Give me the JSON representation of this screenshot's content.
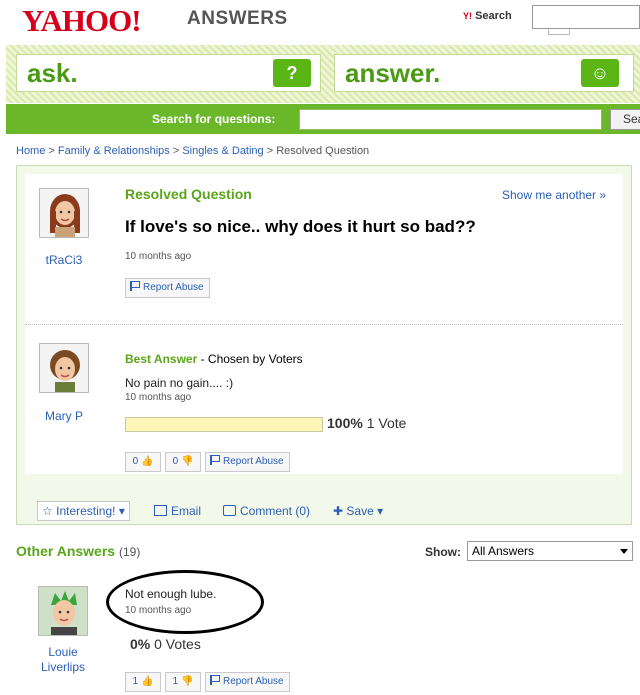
{
  "header": {
    "logo": "YAHOO!",
    "section": "ANSWERS",
    "search_label": "Search",
    "search_logo": "Y!"
  },
  "band": {
    "ask": "ask.",
    "answer": "answer.",
    "ask_icon": "?",
    "answer_icon": "☺"
  },
  "searchbar": {
    "label": "Search for questions:",
    "button": "Search"
  },
  "breadcrumb": {
    "items": [
      "Home",
      "Family & Relationships",
      "Singles & Dating"
    ],
    "current": "Resolved Question",
    "sep": ">"
  },
  "question": {
    "status": "Resolved Question",
    "show_another": "Show me another »",
    "text": "If love's so nice.. why does it hurt so bad??",
    "time": "10 months ago",
    "asker": "tRaCi3",
    "report": "Report Abuse"
  },
  "best_answer": {
    "label": "Best Answer",
    "chosen": " - Chosen by Voters",
    "text": "No pain no gain.... :)",
    "time": "10 months ago",
    "author": "Mary P",
    "percent_label": "100%",
    "votes_label": " 1 Vote",
    "percent": 1.0,
    "thumbs_up": "0",
    "thumbs_down": "0",
    "report": "Report Abuse"
  },
  "actions": {
    "interesting": "Interesting!",
    "email": "Email",
    "comment": "Comment (0)",
    "save": "Save"
  },
  "other_answers": {
    "title": "Other Answers",
    "count": "(19)",
    "show_label": "Show:",
    "show_value": "All Answers",
    "items": [
      {
        "text": "Not enough lube.",
        "time": "10 months ago",
        "author_line1": "Louie",
        "author_line2": "Liverlips",
        "percent_label": "0%",
        "votes_label": " 0 Votes",
        "thumbs_up": "1",
        "thumbs_down": "1",
        "report": "Report Abuse"
      }
    ]
  },
  "colors": {
    "brand_red": "#d6001c",
    "green": "#5aa51b",
    "link": "#2b5fb6"
  }
}
